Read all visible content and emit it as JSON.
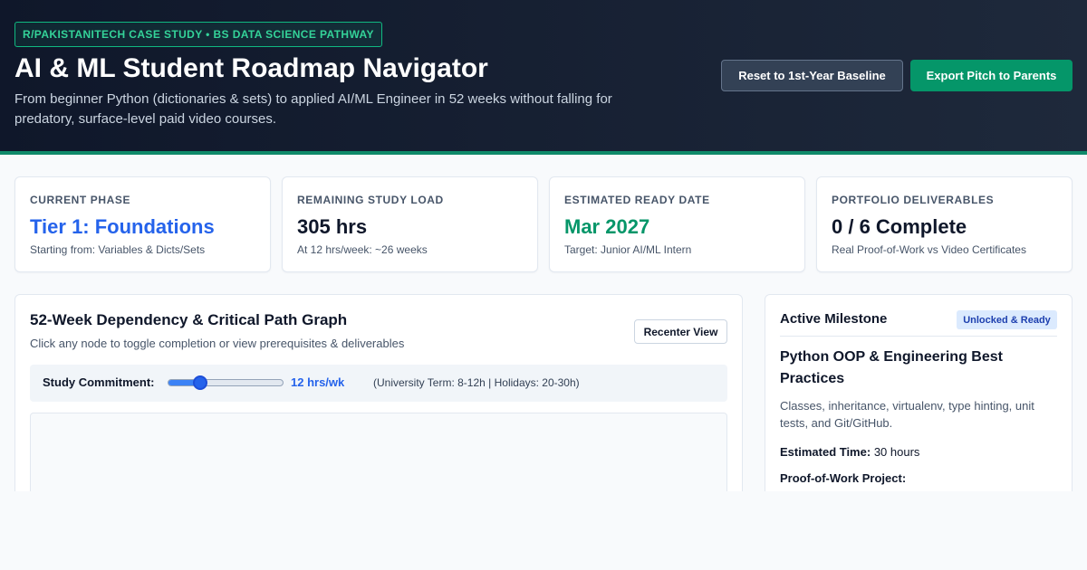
{
  "header": {
    "badge": "R/PAKISTANITECH CASE STUDY • BS DATA SCIENCE PATHWAY",
    "title": "AI & ML Student Roadmap Navigator",
    "subtitle": "From beginner Python (dictionaries & sets) to applied AI/ML Engineer in 52 weeks without falling for predatory, surface-level paid video courses.",
    "reset_label": "Reset to 1st-Year Baseline",
    "export_label": "Export Pitch to Parents"
  },
  "stats": [
    {
      "label": "CURRENT PHASE",
      "value": "Tier 1: Foundations",
      "note": "Starting from: Variables & Dicts/Sets"
    },
    {
      "label": "REMAINING STUDY LOAD",
      "value": "305 hrs",
      "note": "At 12 hrs/week: ~26 weeks"
    },
    {
      "label": "ESTIMATED READY DATE",
      "value": "Mar 2027",
      "note": "Target: Junior AI/ML Intern"
    },
    {
      "label": "PORTFOLIO DELIVERABLES",
      "value": "0 / 6 Complete",
      "note": "Real Proof-of-Work vs Video Certificates"
    }
  ],
  "graph": {
    "title": "52-Week Dependency & Critical Path Graph",
    "hint": "Click any node to toggle completion or view prerequisites & deliverables",
    "recenter_label": "Recenter View",
    "commitment_label": "Study Commitment:",
    "commitment_value": "12 hrs/wk",
    "commitment_fraction": 0.28,
    "commitment_note": "(University Term: 8-12h | Holidays: 20-30h)"
  },
  "milestone": {
    "heading": "Active Milestone",
    "badge": "Unlocked & Ready",
    "title": "Python OOP & Engineering Best Practices",
    "description": "Classes, inheritance, virtualenv, type hinting, unit tests, and Git/GitHub.",
    "time_label": "Estimated Time:",
    "time_value": "30 hours",
    "proof_label": "Proof-of-Work Project:"
  },
  "colors": {
    "accent_green": "#059669",
    "accent_blue": "#2563eb",
    "header_bg": "#0f172a"
  }
}
